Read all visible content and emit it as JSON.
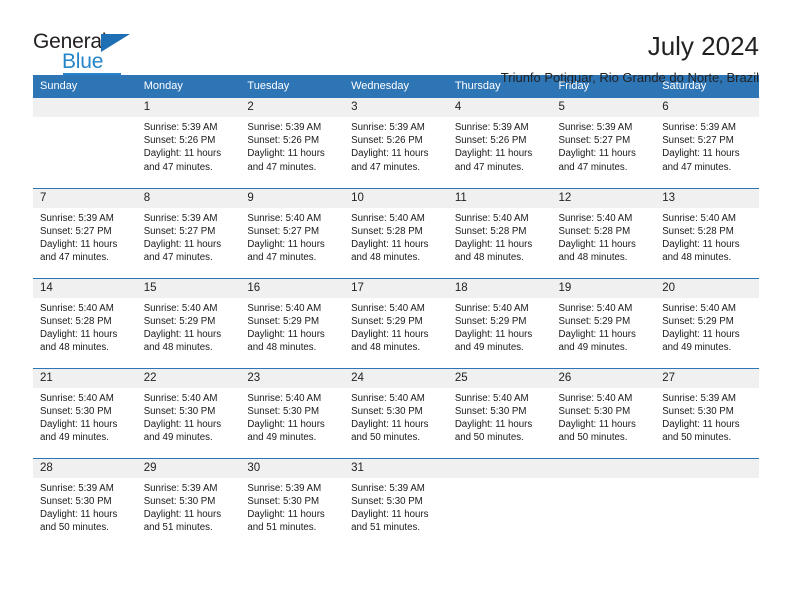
{
  "brand": {
    "name_part1": "General",
    "name_part2": "Blue"
  },
  "header": {
    "title": "July 2024",
    "subtitle": "Triunfo Potiguar, Rio Grande do Norte, Brazil"
  },
  "theme": {
    "header_blue": "#2e75b6",
    "logo_blue": "#2585c8",
    "daynum_band": "#f0f0f0"
  },
  "weekday_headers": [
    "Sunday",
    "Monday",
    "Tuesday",
    "Wednesday",
    "Thursday",
    "Friday",
    "Saturday"
  ],
  "labels": {
    "sunrise_prefix": "Sunrise: ",
    "sunset_prefix": "Sunset: ",
    "daylight_prefix": "Daylight: "
  },
  "weeks": [
    [
      {
        "day": "",
        "empty": true
      },
      {
        "day": "1",
        "sunrise": "Sunrise: 5:39 AM",
        "sunset": "Sunset: 5:26 PM",
        "daylight": "Daylight: 11 hours and 47 minutes."
      },
      {
        "day": "2",
        "sunrise": "Sunrise: 5:39 AM",
        "sunset": "Sunset: 5:26 PM",
        "daylight": "Daylight: 11 hours and 47 minutes."
      },
      {
        "day": "3",
        "sunrise": "Sunrise: 5:39 AM",
        "sunset": "Sunset: 5:26 PM",
        "daylight": "Daylight: 11 hours and 47 minutes."
      },
      {
        "day": "4",
        "sunrise": "Sunrise: 5:39 AM",
        "sunset": "Sunset: 5:26 PM",
        "daylight": "Daylight: 11 hours and 47 minutes."
      },
      {
        "day": "5",
        "sunrise": "Sunrise: 5:39 AM",
        "sunset": "Sunset: 5:27 PM",
        "daylight": "Daylight: 11 hours and 47 minutes."
      },
      {
        "day": "6",
        "sunrise": "Sunrise: 5:39 AM",
        "sunset": "Sunset: 5:27 PM",
        "daylight": "Daylight: 11 hours and 47 minutes."
      }
    ],
    [
      {
        "day": "7",
        "sunrise": "Sunrise: 5:39 AM",
        "sunset": "Sunset: 5:27 PM",
        "daylight": "Daylight: 11 hours and 47 minutes."
      },
      {
        "day": "8",
        "sunrise": "Sunrise: 5:39 AM",
        "sunset": "Sunset: 5:27 PM",
        "daylight": "Daylight: 11 hours and 47 minutes."
      },
      {
        "day": "9",
        "sunrise": "Sunrise: 5:40 AM",
        "sunset": "Sunset: 5:27 PM",
        "daylight": "Daylight: 11 hours and 47 minutes."
      },
      {
        "day": "10",
        "sunrise": "Sunrise: 5:40 AM",
        "sunset": "Sunset: 5:28 PM",
        "daylight": "Daylight: 11 hours and 48 minutes."
      },
      {
        "day": "11",
        "sunrise": "Sunrise: 5:40 AM",
        "sunset": "Sunset: 5:28 PM",
        "daylight": "Daylight: 11 hours and 48 minutes."
      },
      {
        "day": "12",
        "sunrise": "Sunrise: 5:40 AM",
        "sunset": "Sunset: 5:28 PM",
        "daylight": "Daylight: 11 hours and 48 minutes."
      },
      {
        "day": "13",
        "sunrise": "Sunrise: 5:40 AM",
        "sunset": "Sunset: 5:28 PM",
        "daylight": "Daylight: 11 hours and 48 minutes."
      }
    ],
    [
      {
        "day": "14",
        "sunrise": "Sunrise: 5:40 AM",
        "sunset": "Sunset: 5:28 PM",
        "daylight": "Daylight: 11 hours and 48 minutes."
      },
      {
        "day": "15",
        "sunrise": "Sunrise: 5:40 AM",
        "sunset": "Sunset: 5:29 PM",
        "daylight": "Daylight: 11 hours and 48 minutes."
      },
      {
        "day": "16",
        "sunrise": "Sunrise: 5:40 AM",
        "sunset": "Sunset: 5:29 PM",
        "daylight": "Daylight: 11 hours and 48 minutes."
      },
      {
        "day": "17",
        "sunrise": "Sunrise: 5:40 AM",
        "sunset": "Sunset: 5:29 PM",
        "daylight": "Daylight: 11 hours and 48 minutes."
      },
      {
        "day": "18",
        "sunrise": "Sunrise: 5:40 AM",
        "sunset": "Sunset: 5:29 PM",
        "daylight": "Daylight: 11 hours and 49 minutes."
      },
      {
        "day": "19",
        "sunrise": "Sunrise: 5:40 AM",
        "sunset": "Sunset: 5:29 PM",
        "daylight": "Daylight: 11 hours and 49 minutes."
      },
      {
        "day": "20",
        "sunrise": "Sunrise: 5:40 AM",
        "sunset": "Sunset: 5:29 PM",
        "daylight": "Daylight: 11 hours and 49 minutes."
      }
    ],
    [
      {
        "day": "21",
        "sunrise": "Sunrise: 5:40 AM",
        "sunset": "Sunset: 5:30 PM",
        "daylight": "Daylight: 11 hours and 49 minutes."
      },
      {
        "day": "22",
        "sunrise": "Sunrise: 5:40 AM",
        "sunset": "Sunset: 5:30 PM",
        "daylight": "Daylight: 11 hours and 49 minutes."
      },
      {
        "day": "23",
        "sunrise": "Sunrise: 5:40 AM",
        "sunset": "Sunset: 5:30 PM",
        "daylight": "Daylight: 11 hours and 49 minutes."
      },
      {
        "day": "24",
        "sunrise": "Sunrise: 5:40 AM",
        "sunset": "Sunset: 5:30 PM",
        "daylight": "Daylight: 11 hours and 50 minutes."
      },
      {
        "day": "25",
        "sunrise": "Sunrise: 5:40 AM",
        "sunset": "Sunset: 5:30 PM",
        "daylight": "Daylight: 11 hours and 50 minutes."
      },
      {
        "day": "26",
        "sunrise": "Sunrise: 5:40 AM",
        "sunset": "Sunset: 5:30 PM",
        "daylight": "Daylight: 11 hours and 50 minutes."
      },
      {
        "day": "27",
        "sunrise": "Sunrise: 5:39 AM",
        "sunset": "Sunset: 5:30 PM",
        "daylight": "Daylight: 11 hours and 50 minutes."
      }
    ],
    [
      {
        "day": "28",
        "sunrise": "Sunrise: 5:39 AM",
        "sunset": "Sunset: 5:30 PM",
        "daylight": "Daylight: 11 hours and 50 minutes."
      },
      {
        "day": "29",
        "sunrise": "Sunrise: 5:39 AM",
        "sunset": "Sunset: 5:30 PM",
        "daylight": "Daylight: 11 hours and 51 minutes."
      },
      {
        "day": "30",
        "sunrise": "Sunrise: 5:39 AM",
        "sunset": "Sunset: 5:30 PM",
        "daylight": "Daylight: 11 hours and 51 minutes."
      },
      {
        "day": "31",
        "sunrise": "Sunrise: 5:39 AM",
        "sunset": "Sunset: 5:30 PM",
        "daylight": "Daylight: 11 hours and 51 minutes."
      },
      {
        "day": "",
        "empty": true
      },
      {
        "day": "",
        "empty": true
      },
      {
        "day": "",
        "empty": true
      }
    ]
  ]
}
